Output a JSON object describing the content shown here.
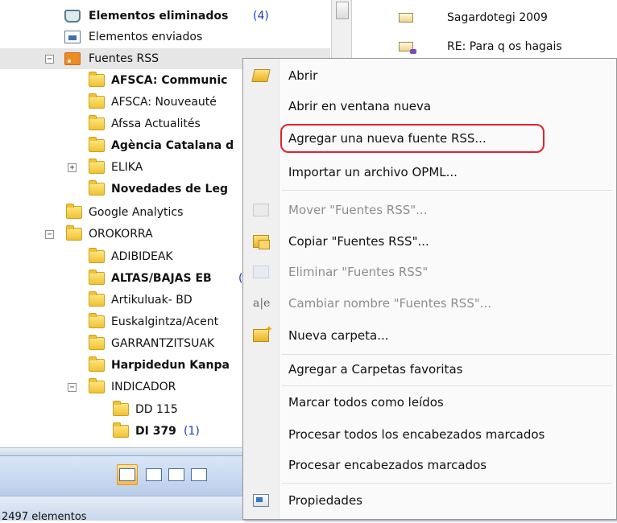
{
  "folder_tree": [
    {
      "label": "Elementos eliminados",
      "count": "(4)",
      "bold": true,
      "icon": "trash-icon",
      "indent": 0,
      "expander": ""
    },
    {
      "label": "Elementos enviados",
      "count": "",
      "bold": false,
      "icon": "sent-items-icon",
      "indent": 0,
      "expander": ""
    },
    {
      "label": "Fuentes RSS",
      "count": "",
      "bold": false,
      "icon": "rss-icon",
      "indent": 0,
      "expander": "−",
      "selected": true
    },
    {
      "label": "AFSCA: Communic",
      "count": "",
      "bold": true,
      "icon": "folder-icon",
      "indent": 1,
      "expander": ""
    },
    {
      "label": "AFSCA: Nouveauté",
      "count": "",
      "bold": false,
      "icon": "folder-icon",
      "indent": 1,
      "expander": ""
    },
    {
      "label": "Afssa Actualités",
      "count": "",
      "bold": false,
      "icon": "folder-icon",
      "indent": 1,
      "expander": ""
    },
    {
      "label": "Agència Catalana d",
      "count": "",
      "bold": true,
      "icon": "folder-icon",
      "indent": 1,
      "expander": ""
    },
    {
      "label": "ELIKA",
      "count": "",
      "bold": false,
      "icon": "folder-icon",
      "indent": 1,
      "expander": "+"
    },
    {
      "label": "Novedades de Leg",
      "count": "",
      "bold": true,
      "icon": "folder-icon",
      "indent": 1,
      "expander": ""
    },
    {
      "label": "Google Analytics",
      "count": "",
      "bold": false,
      "icon": "folder-icon",
      "indent": 0,
      "expander": ""
    },
    {
      "label": "OROKORRA",
      "count": "",
      "bold": false,
      "icon": "folder-icon",
      "indent": 0,
      "expander": "−"
    },
    {
      "label": "ADIBIDEAK",
      "count": "",
      "bold": false,
      "icon": "folder-icon",
      "indent": 1,
      "expander": ""
    },
    {
      "label": "ALTAS/BAJAS EB",
      "count": "(",
      "bold": true,
      "icon": "folder-icon",
      "indent": 1,
      "expander": ""
    },
    {
      "label": "Artikuluak- BD",
      "count": "",
      "bold": false,
      "icon": "folder-icon",
      "indent": 1,
      "expander": ""
    },
    {
      "label": "Euskalgintza/Acent",
      "count": "",
      "bold": false,
      "icon": "folder-icon",
      "indent": 1,
      "expander": ""
    },
    {
      "label": "GARRANTZITSUAK",
      "count": "",
      "bold": false,
      "icon": "folder-icon",
      "indent": 1,
      "expander": ""
    },
    {
      "label": "Harpidedun Kanpa",
      "count": "",
      "bold": true,
      "icon": "folder-icon",
      "indent": 1,
      "expander": ""
    },
    {
      "label": "INDICADOR",
      "count": "",
      "bold": false,
      "icon": "folder-icon",
      "indent": 1,
      "expander": "−"
    },
    {
      "label": "DD 115",
      "count": "",
      "bold": false,
      "icon": "folder-icon",
      "indent": 2,
      "expander": ""
    },
    {
      "label": "DI 379",
      "count": "(1)",
      "bold": true,
      "icon": "folder-icon",
      "indent": 2,
      "expander": ""
    }
  ],
  "messages": [
    {
      "subject": "Sagardotegi 2009",
      "icon": "envelope-icon"
    },
    {
      "subject": "RE: Para q os hagais",
      "icon": "envelope-reply-icon"
    }
  ],
  "context_menu": {
    "items": [
      {
        "id": "abrir",
        "label": "Abrir",
        "icon": "open-folder-icon",
        "enabled": true
      },
      {
        "id": "abrir-ventana",
        "label": "Abrir en ventana nueva",
        "icon": "",
        "enabled": true
      },
      {
        "id": "agregar-fuente",
        "label": "Agregar una nueva fuente RSS...",
        "icon": "",
        "enabled": true,
        "highlighted": true
      },
      {
        "id": "importar-opml",
        "label": "Importar un archivo OPML...",
        "icon": "",
        "enabled": true
      },
      {
        "id": "mover",
        "label": "Mover \"Fuentes RSS\"...",
        "icon": "move-folder-icon",
        "enabled": false
      },
      {
        "id": "copiar",
        "label": "Copiar \"Fuentes RSS\"...",
        "icon": "copy-folder-icon",
        "enabled": true
      },
      {
        "id": "eliminar",
        "label": "Eliminar \"Fuentes RSS\"",
        "icon": "delete-folder-icon",
        "enabled": false
      },
      {
        "id": "renombrar",
        "label": "Cambiar nombre \"Fuentes RSS\"...",
        "icon": "rename-icon",
        "enabled": false
      },
      {
        "id": "nueva-carpeta",
        "label": "Nueva carpeta...",
        "icon": "new-folder-icon",
        "enabled": true
      },
      {
        "id": "favoritas",
        "label": "Agregar a Carpetas favoritas",
        "icon": "",
        "enabled": true
      },
      {
        "id": "marcar-leidos",
        "label": "Marcar todos como leídos",
        "icon": "",
        "enabled": true
      },
      {
        "id": "procesar-todos",
        "label": "Procesar todos los encabezados marcados",
        "icon": "",
        "enabled": true
      },
      {
        "id": "procesar",
        "label": "Procesar encabezados marcados",
        "icon": "",
        "enabled": true
      },
      {
        "id": "propiedades",
        "label": "Propiedades",
        "icon": "properties-icon",
        "enabled": true
      }
    ]
  },
  "status": {
    "text": "2497 elementos"
  },
  "nav_buttons": [
    "mail-icon",
    "calendar-icon",
    "contacts-icon",
    "tasks-icon"
  ],
  "colors": {
    "highlight_border": "#e0222a",
    "unread_count": "#1a3cc8",
    "disabled_text": "#8d8d8d"
  }
}
